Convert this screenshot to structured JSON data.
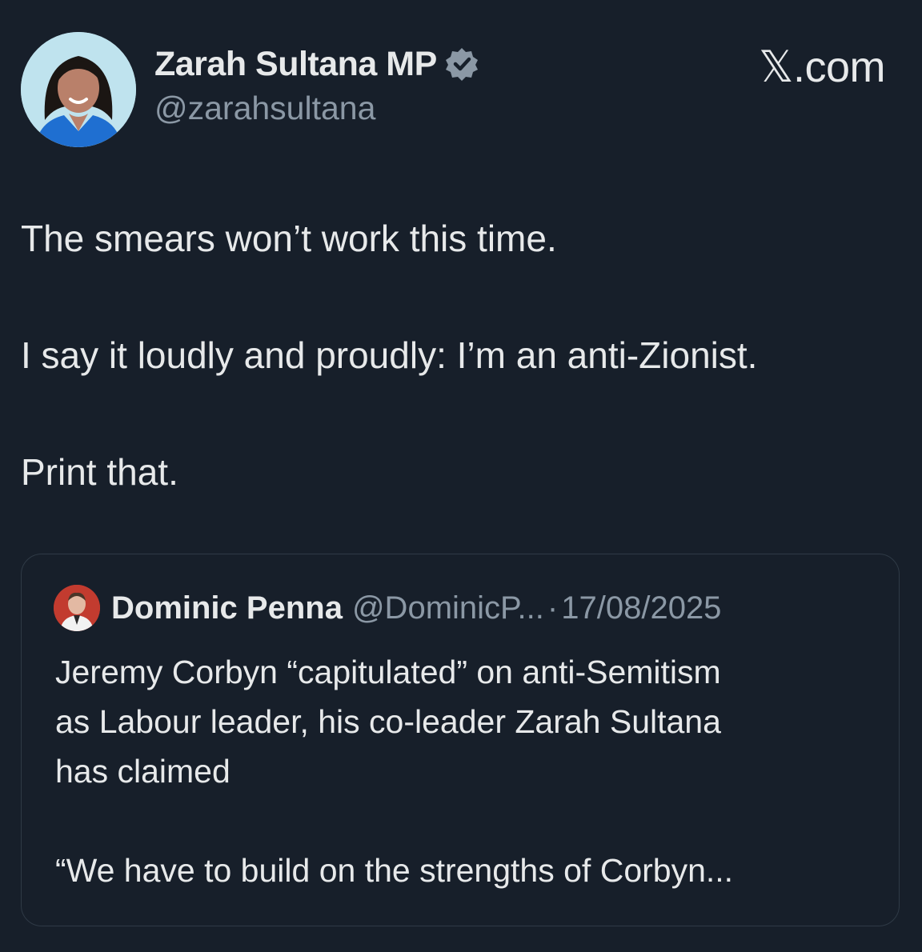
{
  "author": {
    "name": "Zarah Sultana MP",
    "handle": "@zarahsultana",
    "verified_icon": "verified-badge-icon"
  },
  "site_label": "𝕏.com",
  "tweet": {
    "paragraphs": [
      "The smears won’t work this time.",
      "I say it loudly and proudly: I’m an anti-Zionist.",
      "Print that."
    ]
  },
  "quote": {
    "name": "Dominic Penna",
    "handle": "@DominicP...",
    "separator": "·",
    "date": "17/08/2025",
    "lines": [
      "Jeremy Corbyn “capitulated” on anti-Semitism",
      "as Labour leader, his co-leader Zarah Sultana",
      "has claimed"
    ],
    "excerpt": "“We have to build on the strengths of Corbyn..."
  },
  "colors": {
    "background": "#171f2a",
    "text": "#e7e9ea",
    "muted": "#8b98a5",
    "border": "#2f3a46"
  }
}
